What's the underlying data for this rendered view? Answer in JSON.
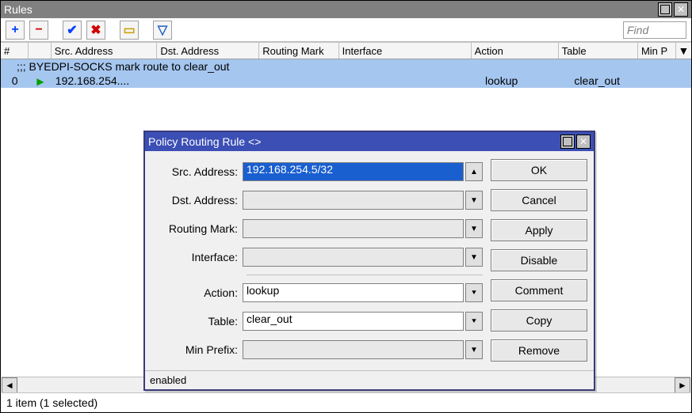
{
  "window": {
    "title": "Rules"
  },
  "toolbar": {
    "find_placeholder": "Find"
  },
  "columns": {
    "num": "#",
    "src": "Src. Address",
    "dst": "Dst. Address",
    "mark": "Routing Mark",
    "iface": "Interface",
    "action": "Action",
    "table": "Table",
    "min": "Min P"
  },
  "rows": {
    "comment": ";;; BYEDPI-SOCKS mark route to clear_out",
    "r0": {
      "num": "0",
      "src": "192.168.254....",
      "action": "lookup",
      "table": "clear_out"
    }
  },
  "status": "1 item (1 selected)",
  "dialog": {
    "title": "Policy Routing Rule <>",
    "labels": {
      "src": "Src. Address:",
      "dst": "Dst. Address:",
      "mark": "Routing Mark:",
      "iface": "Interface:",
      "action": "Action:",
      "table": "Table:",
      "min": "Min Prefix:"
    },
    "values": {
      "src": "192.168.254.5/32",
      "dst": "",
      "mark": "",
      "iface": "",
      "action": "lookup",
      "table": "clear_out",
      "min": ""
    },
    "buttons": {
      "ok": "OK",
      "cancel": "Cancel",
      "apply": "Apply",
      "disable": "Disable",
      "comment": "Comment",
      "copy": "Copy",
      "remove": "Remove"
    },
    "status": "enabled"
  }
}
